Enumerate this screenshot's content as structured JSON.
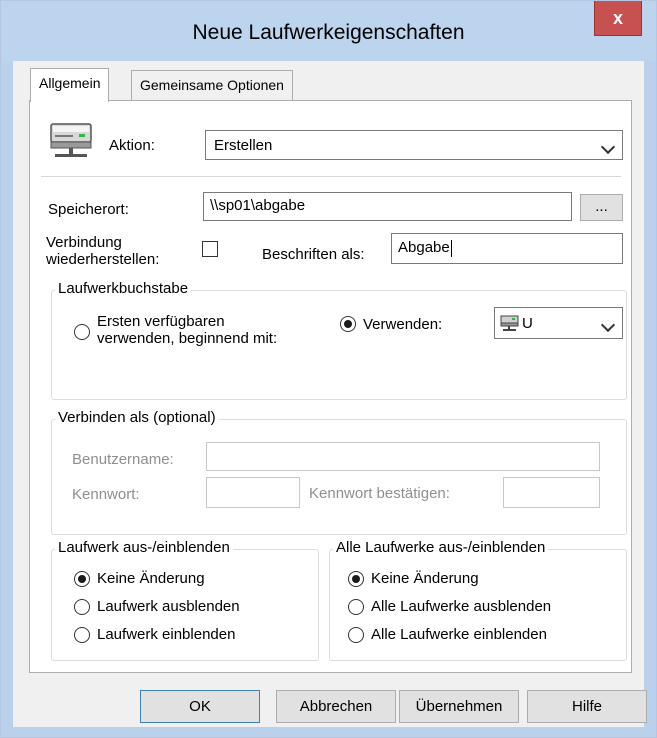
{
  "window": {
    "title": "Neue Laufwerkeigenschaften",
    "close_glyph": "x"
  },
  "tabs": [
    {
      "label": "Allgemein",
      "active": true
    },
    {
      "label": "Gemeinsame Optionen",
      "active": false
    }
  ],
  "general": {
    "action_label": "Aktion:",
    "action_value": "Erstellen",
    "location_label": "Speicherort:",
    "location_value": "\\\\sp01\\abgabe",
    "browse_label": "...",
    "reconnect_label_line1": "Verbindung",
    "reconnect_label_line2": "wiederherstellen:",
    "reconnect_checked": false,
    "label_as_label": "Beschriften als:",
    "label_as_value": "Abgabe"
  },
  "drive_letter": {
    "group_title": "Laufwerkbuchstabe",
    "first_available_line1": "Ersten verfügbaren",
    "first_available_line2": "verwenden, beginnend mit:",
    "use_label": "Verwenden:",
    "use_selected": true,
    "drive_value": "U"
  },
  "connect_as": {
    "group_title": "Verbinden als (optional)",
    "username_label": "Benutzername:",
    "password_label": "Kennwort:",
    "confirm_label": "Kennwort bestätigen:"
  },
  "hide_show_drive": {
    "group_title": "Laufwerk aus-/einblenden",
    "options": [
      "Keine Änderung",
      "Laufwerk ausblenden",
      "Laufwerk einblenden"
    ],
    "selected_index": 0
  },
  "hide_show_all": {
    "group_title": "Alle Laufwerke aus-/einblenden",
    "options": [
      "Keine Änderung",
      "Alle Laufwerke ausblenden",
      "Alle Laufwerke einblenden"
    ],
    "selected_index": 0
  },
  "buttons": {
    "ok": "OK",
    "cancel": "Abbrechen",
    "apply": "Übernehmen",
    "help": "Hilfe"
  }
}
